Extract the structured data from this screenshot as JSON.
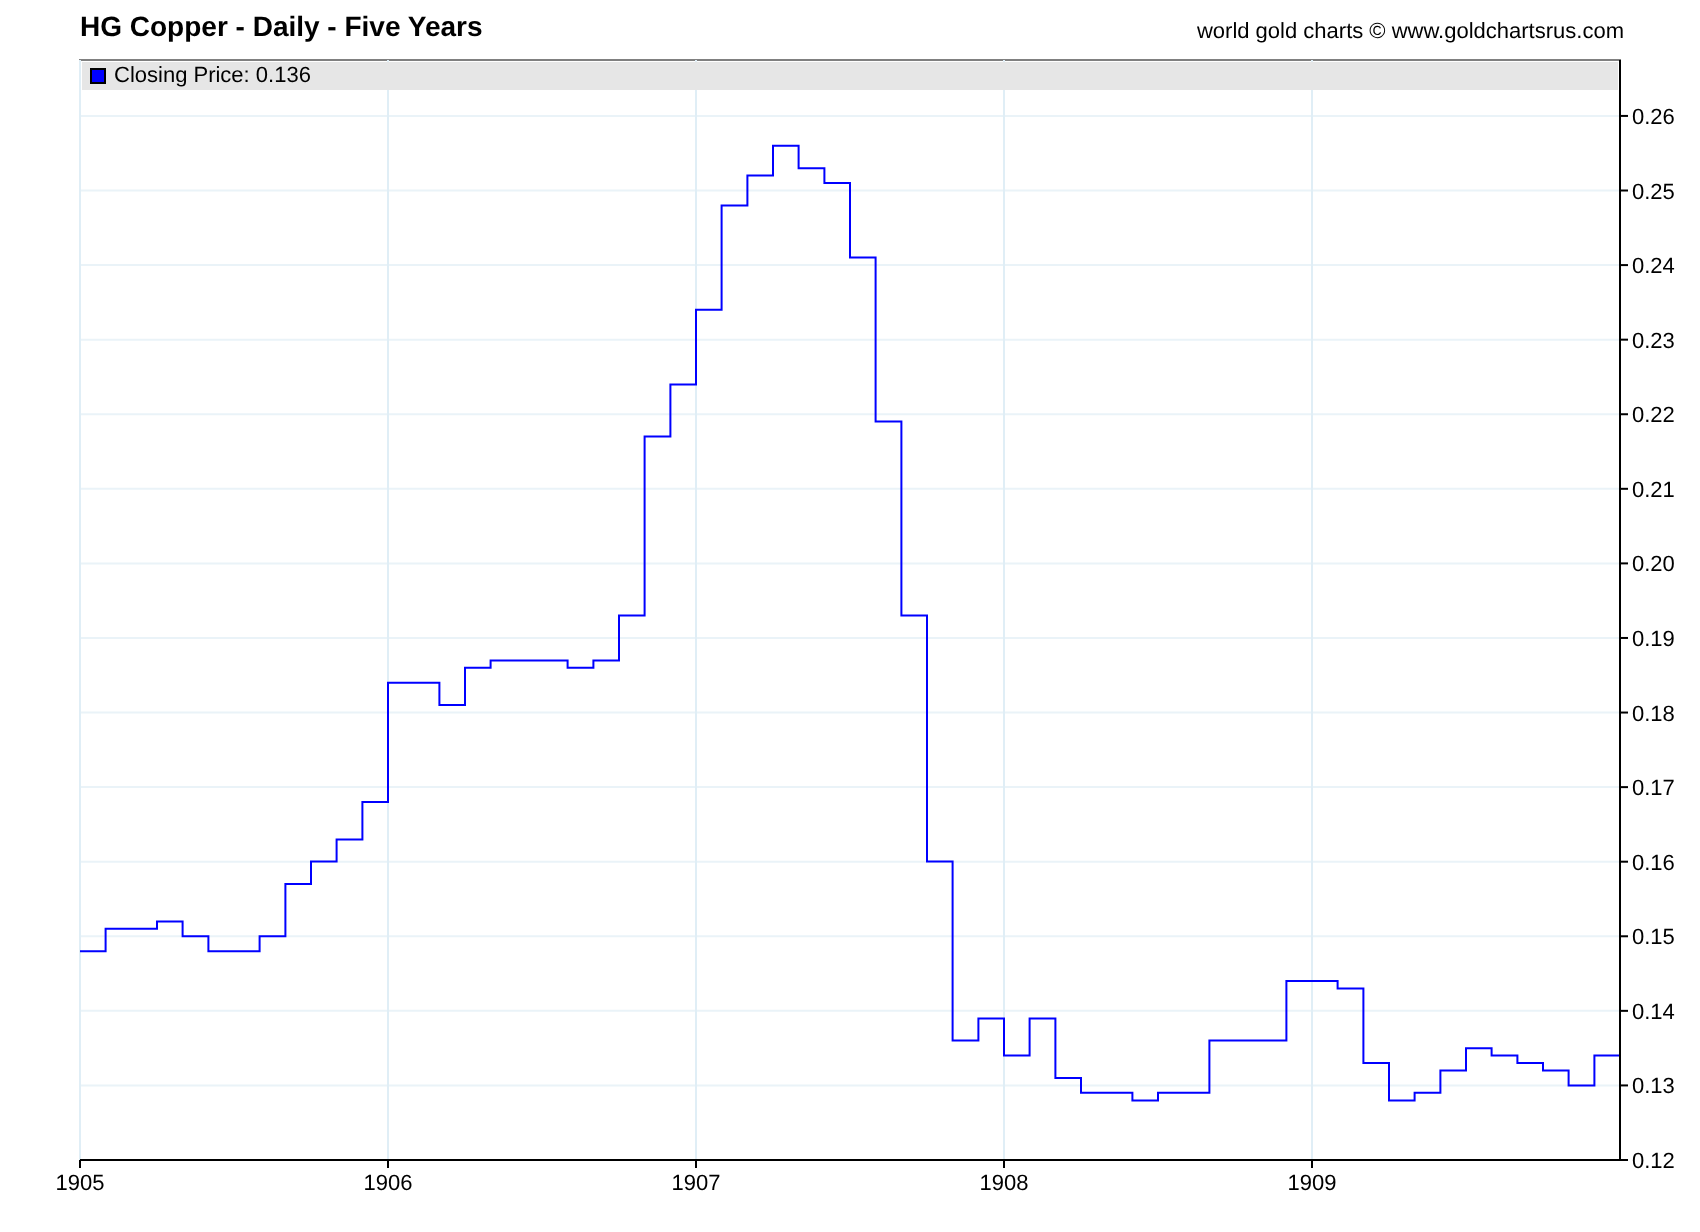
{
  "header": {
    "credit": "world gold charts © www.goldchartsrus.com"
  },
  "legend": {
    "suffix": ": 0.136"
  },
  "chart_data": {
    "type": "line",
    "title": "HG Copper - Daily - Five Years",
    "grid": true,
    "x": [
      1905,
      1905.083,
      1905.083,
      1905.25,
      1905.25,
      1905.333,
      1905.333,
      1905.417,
      1905.417,
      1905.583,
      1905.583,
      1905.667,
      1905.667,
      1905.75,
      1905.75,
      1905.833,
      1905.833,
      1905.917,
      1905.917,
      1906,
      1906,
      1906.167,
      1906.167,
      1906.25,
      1906.25,
      1906.333,
      1906.333,
      1906.583,
      1906.583,
      1906.667,
      1906.667,
      1906.75,
      1906.75,
      1906.833,
      1906.833,
      1906.917,
      1906.917,
      1907,
      1907,
      1907.083,
      1907.083,
      1907.167,
      1907.167,
      1907.25,
      1907.25,
      1907.333,
      1907.333,
      1907.417,
      1907.417,
      1907.5,
      1907.5,
      1907.583,
      1907.583,
      1907.667,
      1907.667,
      1907.75,
      1907.75,
      1907.833,
      1907.833,
      1907.917,
      1907.917,
      1908,
      1908,
      1908.083,
      1908.083,
      1908.167,
      1908.167,
      1908.25,
      1908.25,
      1908.417,
      1908.417,
      1908.5,
      1908.5,
      1908.667,
      1908.667,
      1908.917,
      1908.917,
      1909.083,
      1909.083,
      1909.167,
      1909.167,
      1909.25,
      1909.25,
      1909.333,
      1909.333,
      1909.417,
      1909.417,
      1909.5,
      1909.5,
      1909.583,
      1909.583,
      1909.667,
      1909.667,
      1909.75,
      1909.75,
      1909.833,
      1909.833,
      1909.917,
      1909.917,
      1910
    ],
    "series": [
      {
        "name": "Closing Price",
        "color": "#0000ff",
        "values": [
          0.148,
          0.148,
          0.151,
          0.151,
          0.152,
          0.152,
          0.15,
          0.15,
          0.148,
          0.148,
          0.15,
          0.15,
          0.157,
          0.157,
          0.16,
          0.16,
          0.163,
          0.163,
          0.168,
          0.168,
          0.184,
          0.184,
          0.181,
          0.181,
          0.186,
          0.186,
          0.187,
          0.187,
          0.186,
          0.186,
          0.187,
          0.187,
          0.193,
          0.193,
          0.217,
          0.217,
          0.224,
          0.224,
          0.234,
          0.234,
          0.248,
          0.248,
          0.252,
          0.252,
          0.256,
          0.256,
          0.253,
          0.253,
          0.251,
          0.251,
          0.241,
          0.241,
          0.219,
          0.219,
          0.193,
          0.193,
          0.16,
          0.16,
          0.136,
          0.136,
          0.139,
          0.139,
          0.134,
          0.134,
          0.139,
          0.139,
          0.131,
          0.131,
          0.129,
          0.129,
          0.128,
          0.128,
          0.129,
          0.129,
          0.136,
          0.136,
          0.144,
          0.144,
          0.143,
          0.143,
          0.133,
          0.133,
          0.128,
          0.128,
          0.129,
          0.129,
          0.132,
          0.132,
          0.135,
          0.135,
          0.134,
          0.134,
          0.133,
          0.133,
          0.132,
          0.132,
          0.13,
          0.13,
          0.134,
          0.134
        ]
      }
    ],
    "xlim": [
      1905,
      1910
    ],
    "ylim": [
      0.12,
      0.2675
    ],
    "xticks": [
      1905,
      1906,
      1907,
      1908,
      1909
    ],
    "yticks": [
      {
        "value": 0.12,
        "label": "0.12"
      },
      {
        "value": 0.13,
        "label": "0.13"
      },
      {
        "value": 0.14,
        "label": "0.14"
      },
      {
        "value": 0.15,
        "label": "0.15"
      },
      {
        "value": 0.16,
        "label": "0.16"
      },
      {
        "value": 0.17,
        "label": "0.17"
      },
      {
        "value": 0.18,
        "label": "0.18"
      },
      {
        "value": 0.19,
        "label": "0.19"
      },
      {
        "value": 0.2,
        "label": "0.20"
      },
      {
        "value": 0.21,
        "label": "0.21"
      },
      {
        "value": 0.22,
        "label": "0.22"
      },
      {
        "value": 0.23,
        "label": "0.23"
      },
      {
        "value": 0.24,
        "label": "0.24"
      },
      {
        "value": 0.25,
        "label": "0.25"
      },
      {
        "value": 0.26,
        "label": "0.26"
      }
    ]
  }
}
